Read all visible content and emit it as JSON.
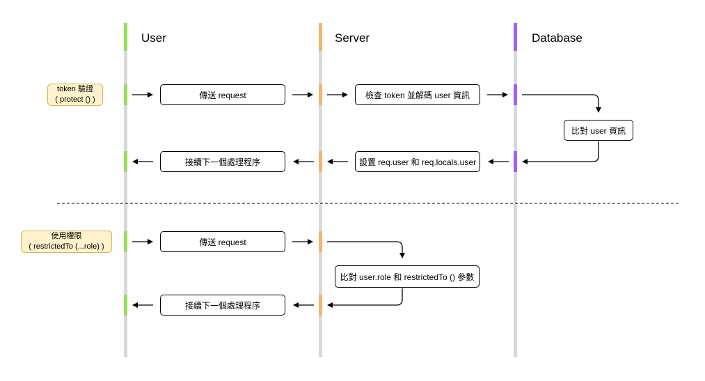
{
  "lanes": {
    "user": "User",
    "server": "Server",
    "database": "Database"
  },
  "section1": {
    "note": [
      "token 驗證",
      "( protect () )"
    ],
    "send_request": "傳送 request",
    "check_token": "檢查 token 並解碼 user 資訊",
    "compare_user": "比對 user 資訊",
    "set_user": "設置 req.user 和 req.locals.user",
    "continue": "接續下一個處理程序"
  },
  "section2": {
    "note": [
      "使用權限",
      "( restrictedTo (...role) )"
    ],
    "send_request": "傳送 request",
    "compare_role": "比對 user.role 和 restrictedTo () 參數",
    "continue": "接續下一個處理程序"
  },
  "colors": {
    "user": "#97e05a",
    "server": "#f7b36e",
    "database": "#a55ff0",
    "lifeline": "#d9d9d9",
    "note_fill": "#fff2cc",
    "note_border": "#d6b656"
  }
}
